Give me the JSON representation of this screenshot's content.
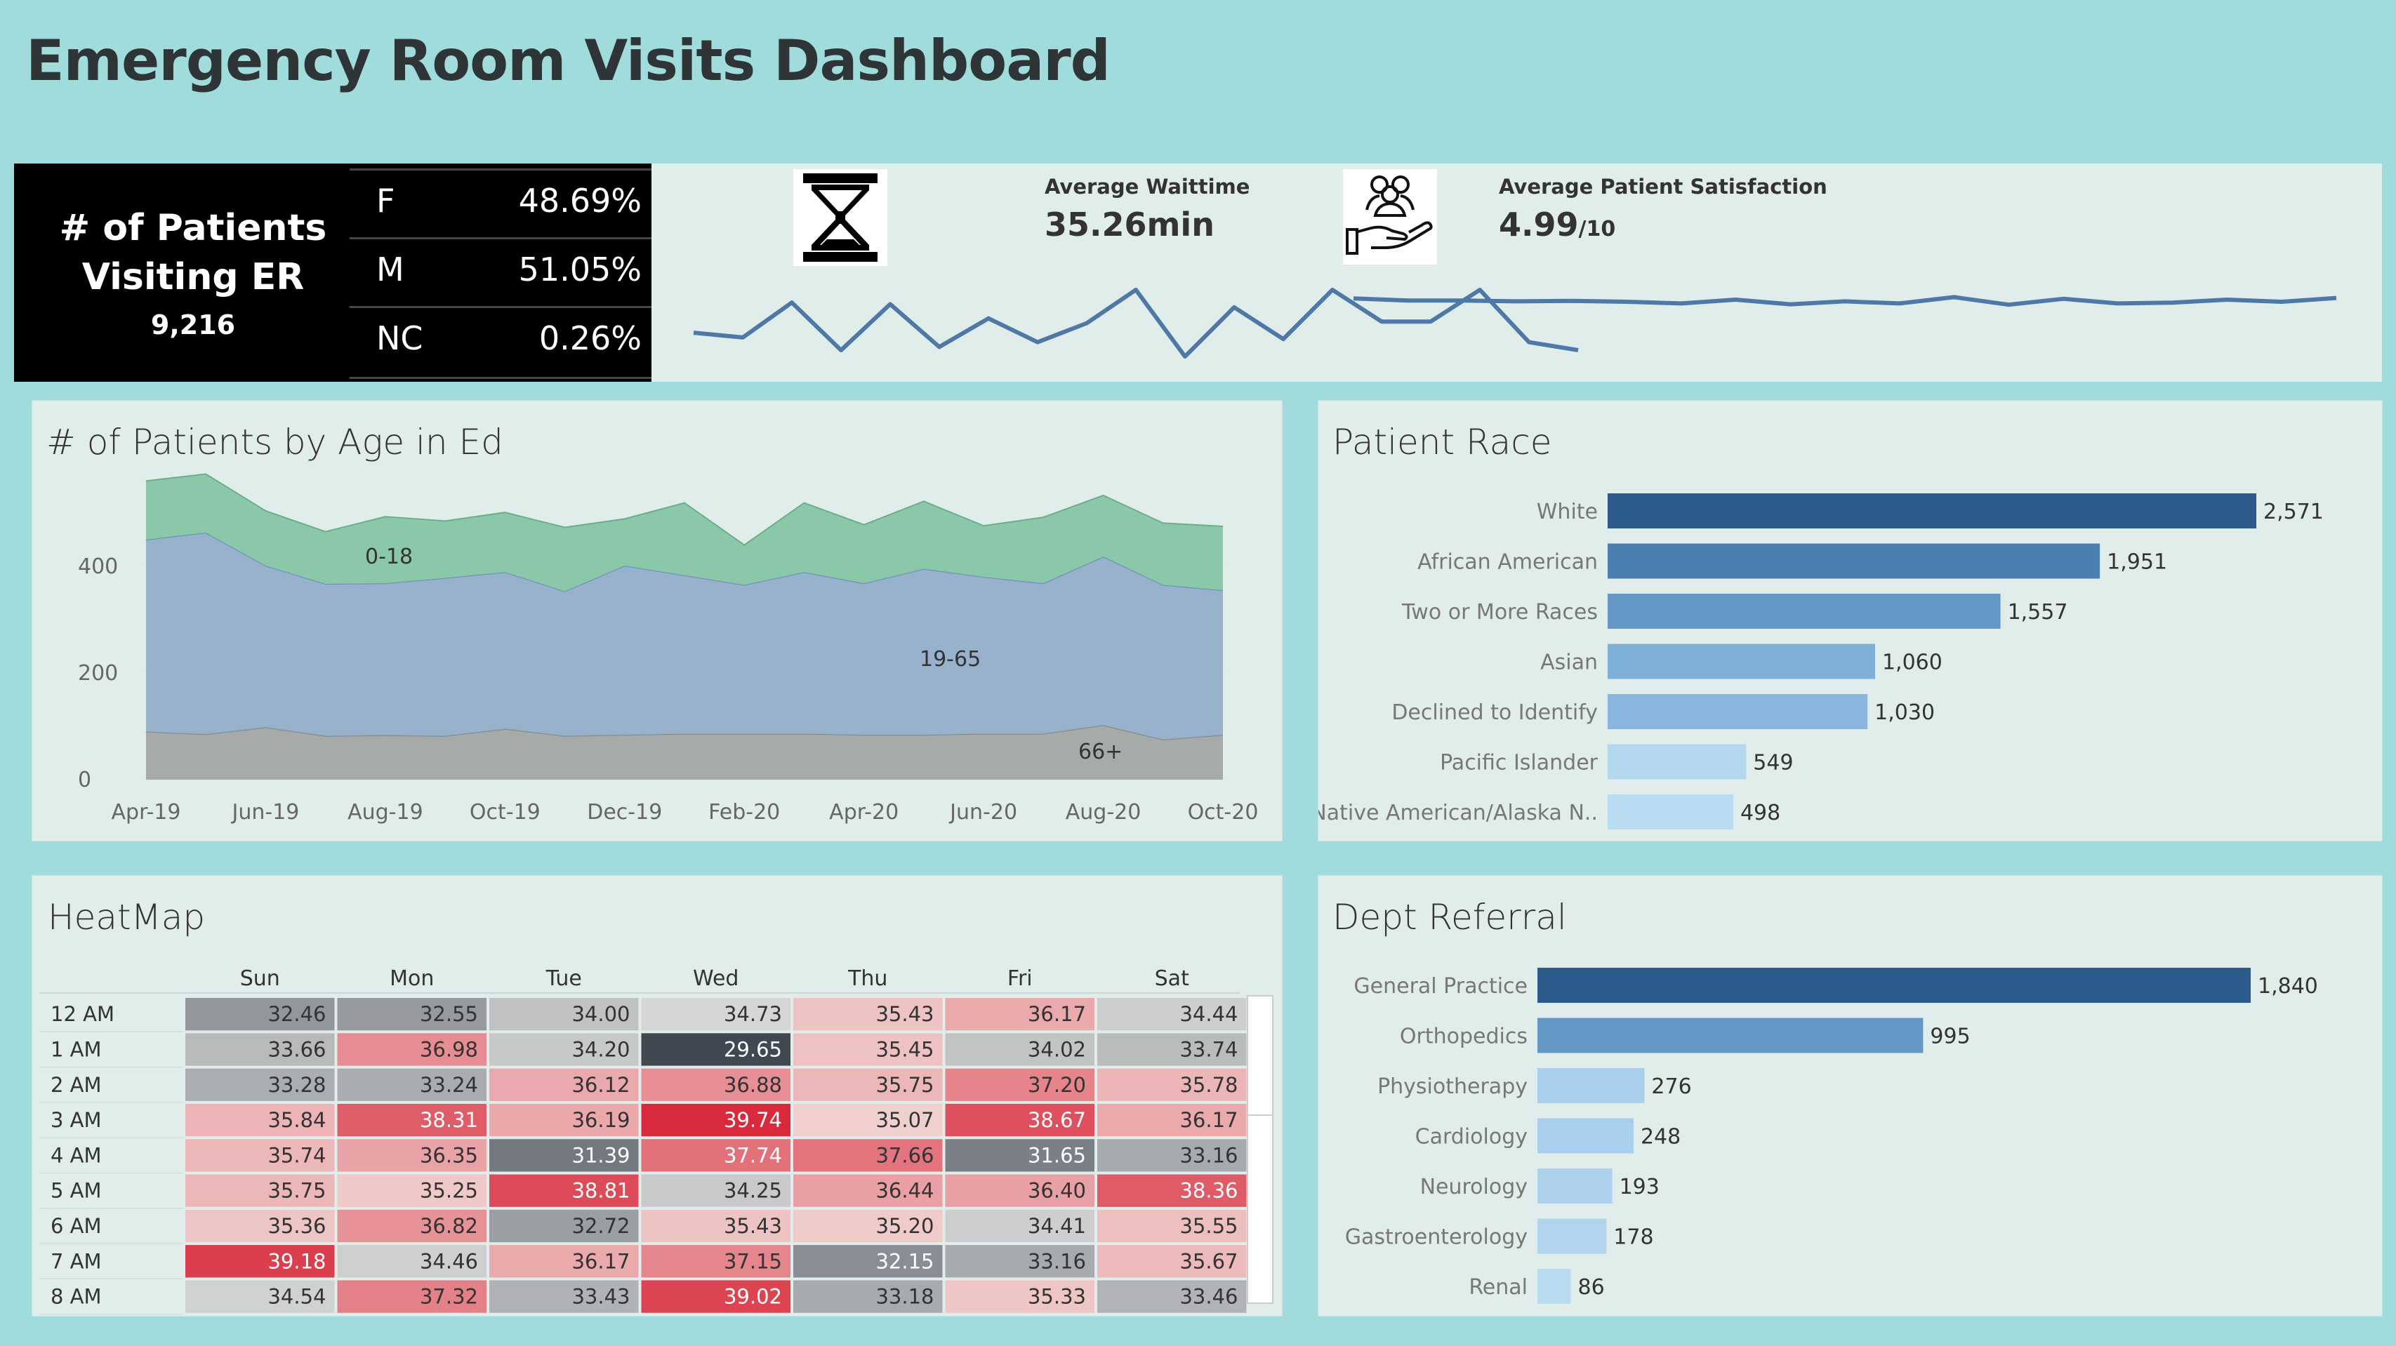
{
  "title": "Emergency Room Visits Dashboard",
  "patients": {
    "label_line1": "# of Patients",
    "label_line2": "Visiting ER",
    "total": "9,216",
    "gender": [
      {
        "key": "F",
        "value": "48.69%"
      },
      {
        "key": "M",
        "value": "51.05%"
      },
      {
        "key": "NC",
        "value": "0.26%"
      }
    ]
  },
  "waittime": {
    "label": "Average Waittime",
    "value": "35.26min",
    "icon": "hourglass-icon"
  },
  "satisfaction": {
    "label": "Average Patient Satisfaction",
    "value": "4.99",
    "suffix": "/10",
    "icon": "people-hand-icon"
  },
  "colors": {
    "teal_bg": "#9fdcdb",
    "panel_bg": "#e1edea",
    "sparkline": "#4e79a7",
    "area_0_18": "#86c6a6",
    "area_19_65": "#93aecb",
    "area_66": "#a2a6a5",
    "heat_red": "#d8283a",
    "heat_gray": "#3f4751"
  },
  "chart_data": [
    {
      "id": "waittime-sparkline",
      "type": "line",
      "values": [
        35.2,
        34.9,
        37.1,
        34.1,
        37.0,
        34.3,
        36.1,
        34.6,
        35.8,
        37.9,
        33.7,
        36.8,
        34.8,
        37.9,
        35.9,
        35.9,
        37.9,
        34.6,
        34.1
      ]
    },
    {
      "id": "satisfaction-sparkline",
      "type": "line",
      "values": [
        5.03,
        4.98,
        4.98,
        4.96,
        4.97,
        4.95,
        4.91,
        5.0,
        4.89,
        4.96,
        4.91,
        5.06,
        4.88,
        5.02,
        4.91,
        4.93,
        5.0,
        4.95,
        5.04
      ]
    },
    {
      "id": "age-area",
      "type": "area",
      "title": "# of Patients by Age in Ed",
      "x": [
        "Apr-19",
        "May-19",
        "Jun-19",
        "Jul-19",
        "Aug-19",
        "Sep-19",
        "Oct-19",
        "Nov-19",
        "Dec-19",
        "Jan-20",
        "Feb-20",
        "Mar-20",
        "Apr-20",
        "May-20",
        "Jun-20",
        "Jul-20",
        "Aug-20",
        "Sep-20",
        "Oct-20"
      ],
      "xticks": [
        "Apr-19",
        "Jun-19",
        "Aug-19",
        "Oct-19",
        "Dec-19",
        "Feb-20",
        "Apr-20",
        "Jun-20",
        "Aug-20",
        "Oct-20"
      ],
      "yticks": [
        0,
        200,
        400
      ],
      "ylim": [
        0,
        540
      ],
      "series": [
        {
          "name": "66+",
          "values": [
            90,
            85,
            98,
            82,
            83,
            82,
            95,
            82,
            84,
            86,
            86,
            86,
            84,
            84,
            86,
            86,
            102,
            75,
            84
          ]
        },
        {
          "name": "19-65",
          "values": [
            360,
            378,
            303,
            285,
            285,
            296,
            294,
            271,
            317,
            297,
            279,
            303,
            284,
            311,
            294,
            282,
            316,
            290,
            271
          ]
        },
        {
          "name": "0-18",
          "values": [
            110,
            110,
            103,
            98,
            125,
            107,
            112,
            120,
            88,
            136,
            75,
            130,
            110,
            127,
            96,
            124,
            115,
            116,
            120
          ]
        }
      ]
    },
    {
      "id": "patient-race",
      "type": "bar",
      "title": "Patient Race",
      "categories": [
        "White",
        "African American",
        "Two or More Races",
        "Asian",
        "Declined to Identify",
        "Pacific Islander",
        "Native American/Alaska N.."
      ],
      "values": [
        2571,
        1951,
        1557,
        1060,
        1030,
        549,
        498
      ],
      "labels": [
        "2,571",
        "1,951",
        "1,557",
        "1,060",
        "1,030",
        "549",
        "498"
      ],
      "colors": [
        "#2c5a8b",
        "#4a7fb0",
        "#6497c4",
        "#7fb0d8",
        "#88b6de",
        "#b2d7ee",
        "#b9dcf1"
      ]
    },
    {
      "id": "heatmap",
      "type": "heatmap",
      "title": "HeatMap",
      "columns": [
        "Sun",
        "Mon",
        "Tue",
        "Wed",
        "Thu",
        "Fri",
        "Sat"
      ],
      "rows": [
        "12 AM",
        "1 AM",
        "2 AM",
        "3 AM",
        "4 AM",
        "5 AM",
        "6 AM",
        "7 AM",
        "8 AM"
      ],
      "values": [
        [
          "32.46",
          "32.55",
          "34.00",
          "34.73",
          "35.43",
          "36.17",
          "34.44"
        ],
        [
          "33.66",
          "36.98",
          "34.20",
          "29.65",
          "35.45",
          "34.02",
          "33.74"
        ],
        [
          "33.28",
          "33.24",
          "36.12",
          "36.88",
          "35.75",
          "37.20",
          "35.78"
        ],
        [
          "35.84",
          "38.31",
          "36.19",
          "39.74",
          "35.07",
          "38.67",
          "36.17"
        ],
        [
          "35.74",
          "36.35",
          "31.39",
          "37.74",
          "37.66",
          "31.65",
          "33.16"
        ],
        [
          "35.75",
          "35.25",
          "38.81",
          "34.25",
          "36.44",
          "36.40",
          "38.36"
        ],
        [
          "35.36",
          "36.82",
          "32.72",
          "35.43",
          "35.20",
          "34.41",
          "35.55"
        ],
        [
          "39.18",
          "34.46",
          "36.17",
          "37.15",
          "32.15",
          "33.16",
          "35.67"
        ],
        [
          "34.54",
          "37.32",
          "33.43",
          "39.02",
          "33.18",
          "35.33",
          "33.46"
        ]
      ],
      "center": 35.0
    },
    {
      "id": "dept-referral",
      "type": "bar",
      "title": "Dept Referral",
      "categories": [
        "General Practice",
        "Orthopedics",
        "Physiotherapy",
        "Cardiology",
        "Neurology",
        "Gastroenterology",
        "Renal"
      ],
      "values": [
        1840,
        995,
        276,
        248,
        193,
        178,
        86
      ],
      "labels": [
        "1,840",
        "995",
        "276",
        "248",
        "193",
        "178",
        "86"
      ],
      "colors": [
        "#2c5a8b",
        "#6497c4",
        "#a8cfec",
        "#a8cfec",
        "#aed2ee",
        "#b2d5ef",
        "#b9dcf1"
      ]
    }
  ]
}
